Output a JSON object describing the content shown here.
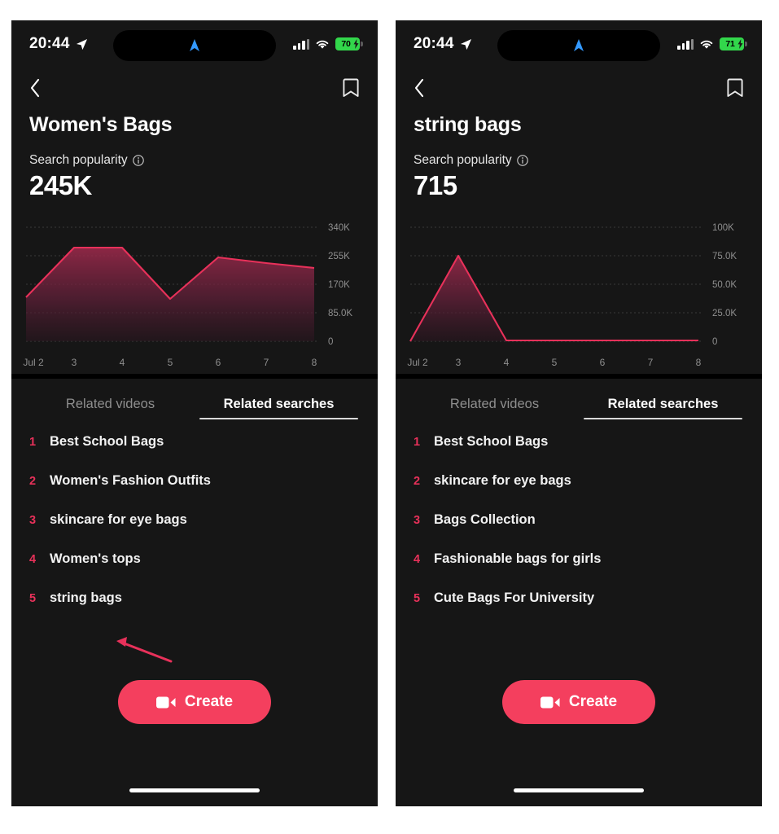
{
  "panels": [
    {
      "id": "left",
      "status_bar": {
        "time": "20:44",
        "location_icon": "location-arrow-icon",
        "dynamic_island_icon": "navigation-arrow-icon",
        "signal_icon": "cellular-bars-icon",
        "wifi_icon": "wifi-icon",
        "battery_percent": "70",
        "battery_charging": true,
        "battery_color": "#32d74b"
      },
      "nav": {
        "back_icon": "chevron-left-icon",
        "bookmark_icon": "bookmark-icon"
      },
      "keyword_title": "Women's Bags",
      "search_popularity_label": "Search popularity",
      "info_icon": "info-circle-icon",
      "search_popularity_value": "245K",
      "tabs": [
        {
          "label": "Related videos",
          "active": false
        },
        {
          "label": "Related searches",
          "active": true
        }
      ],
      "related_searches": [
        {
          "rank": "1",
          "query": "Best School Bags"
        },
        {
          "rank": "2",
          "query": "Women's Fashion Outfits"
        },
        {
          "rank": "3",
          "query": "skincare for eye bags"
        },
        {
          "rank": "4",
          "query": "Women's tops"
        },
        {
          "rank": "5",
          "query": "string bags"
        }
      ],
      "create_button": {
        "label": "Create",
        "icon": "video-camera-icon",
        "color": "#f43f5e"
      }
    },
    {
      "id": "right",
      "status_bar": {
        "time": "20:44",
        "location_icon": "location-arrow-icon",
        "dynamic_island_icon": "navigation-arrow-icon",
        "signal_icon": "cellular-bars-icon",
        "wifi_icon": "wifi-icon",
        "battery_percent": "71",
        "battery_charging": true,
        "battery_color": "#32d74b"
      },
      "nav": {
        "back_icon": "chevron-left-icon",
        "bookmark_icon": "bookmark-icon"
      },
      "keyword_title": "string bags",
      "search_popularity_label": "Search popularity",
      "info_icon": "info-circle-icon",
      "search_popularity_value": "715",
      "tabs": [
        {
          "label": "Related videos",
          "active": false
        },
        {
          "label": "Related searches",
          "active": true
        }
      ],
      "related_searches": [
        {
          "rank": "1",
          "query": "Best School Bags"
        },
        {
          "rank": "2",
          "query": "skincare for eye bags"
        },
        {
          "rank": "3",
          "query": "Bags Collection"
        },
        {
          "rank": "4",
          "query": "Fashionable bags for girls"
        },
        {
          "rank": "5",
          "query": "Cute Bags For University"
        }
      ],
      "create_button": {
        "label": "Create",
        "icon": "video-camera-icon",
        "color": "#f43f5e"
      }
    }
  ],
  "annotation": {
    "type": "arrow",
    "color": "#e8315a",
    "points_to": "string bags",
    "panel": "left"
  },
  "chart_data": [
    {
      "type": "area",
      "title": "Search popularity - Women's Bags",
      "panel": "left",
      "categories": [
        "Jul 2",
        "3",
        "4",
        "5",
        "6",
        "7",
        "8"
      ],
      "x": [
        "Jul 2",
        "3",
        "4",
        "5",
        "6",
        "7",
        "8"
      ],
      "values": [
        130000,
        300000,
        300000,
        130000,
        275000,
        260000,
        245000
      ],
      "series": [
        {
          "name": "Search popularity",
          "values": [
            130000,
            300000,
            300000,
            130000,
            275000,
            260000,
            245000
          ]
        }
      ],
      "ytick_labels": [
        "340K",
        "255K",
        "170K",
        "85.0K",
        "0"
      ],
      "ytick_values": [
        340000,
        255000,
        170000,
        85000,
        0
      ],
      "ylim": [
        0,
        340000
      ],
      "xlabel": "",
      "ylabel": "",
      "grid": true,
      "legend": "none",
      "line_color": "#e8315a",
      "fill_gradient": [
        "#8d2240",
        "#2a1520"
      ]
    },
    {
      "type": "area",
      "title": "Search popularity - string bags",
      "panel": "right",
      "categories": [
        "Jul 2",
        "3",
        "4",
        "5",
        "6",
        "7",
        "8"
      ],
      "x": [
        "Jul 2",
        "3",
        "4",
        "5",
        "6",
        "7",
        "8"
      ],
      "values": [
        0,
        75000,
        700,
        700,
        700,
        700,
        715
      ],
      "series": [
        {
          "name": "Search popularity",
          "values": [
            0,
            75000,
            700,
            700,
            700,
            700,
            715
          ]
        }
      ],
      "ytick_labels": [
        "100K",
        "75.0K",
        "50.0K",
        "25.0K",
        "0"
      ],
      "ytick_values": [
        100000,
        75000,
        50000,
        25000,
        0
      ],
      "ylim": [
        0,
        100000
      ],
      "xlabel": "",
      "ylabel": "",
      "grid": true,
      "legend": "none",
      "line_color": "#e8315a",
      "fill_gradient": [
        "#8d2240",
        "#2a1520"
      ]
    }
  ]
}
